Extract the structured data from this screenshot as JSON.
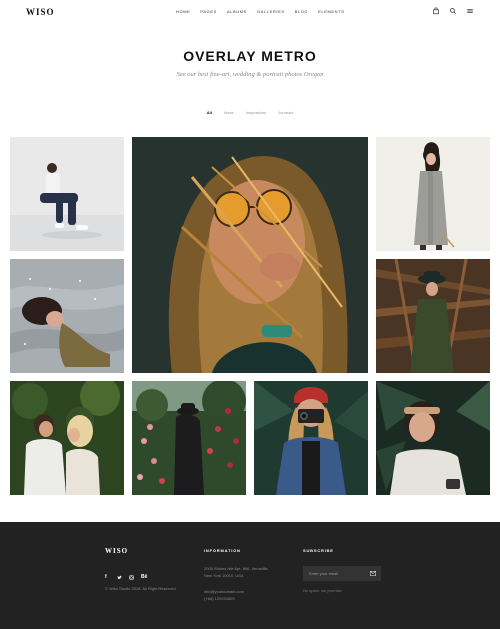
{
  "header": {
    "logo": "WISO",
    "nav": [
      "Home",
      "Pages",
      "Albums",
      "Galleries",
      "Blog",
      "Elements"
    ],
    "icons": [
      "cart-icon",
      "search-icon",
      "menu-icon"
    ]
  },
  "page": {
    "title": "OVERLAY METRO",
    "subtitle": "See our best fine-art, wedding & portrait photos Oregon"
  },
  "filters": [
    {
      "label": "All",
      "active": true
    },
    {
      "label": "Ideas",
      "active": false
    },
    {
      "label": "Inspirations",
      "active": false
    },
    {
      "label": "Journals",
      "active": false
    }
  ],
  "gallery": [
    "photo-man-sitting-sneakers",
    "photo-woman-orange-sunglasses",
    "photo-woman-grey-coat",
    "photo-woman-lying-bed",
    "photo-woman-hat-branches",
    "photo-couple-embrace",
    "photo-woman-rose-bush",
    "photo-woman-red-beanie-camera",
    "photo-woman-headband-leaves"
  ],
  "footer": {
    "logo": "WISO",
    "copyright": "© Wiso Studio 2018. All Right Reserved.",
    "socials": [
      "facebook-icon",
      "twitter-icon",
      "instagram-icon",
      "behance-icon"
    ],
    "information": {
      "heading": "INFORMATION",
      "address_line1": "2005 Stokes Isle Apt. 896, Venaville,",
      "address_line2": "New York 10010, USA",
      "email": "info@yourdomain.com",
      "phone": "(+68) 120034509"
    },
    "subscribe": {
      "heading": "SUBSCRIBE",
      "placeholder": "Enter your email",
      "note": "No spam, we promise"
    }
  },
  "colors": {
    "footer_bg": "#222222",
    "input_bg": "#333333",
    "accent_text": "#111111"
  }
}
